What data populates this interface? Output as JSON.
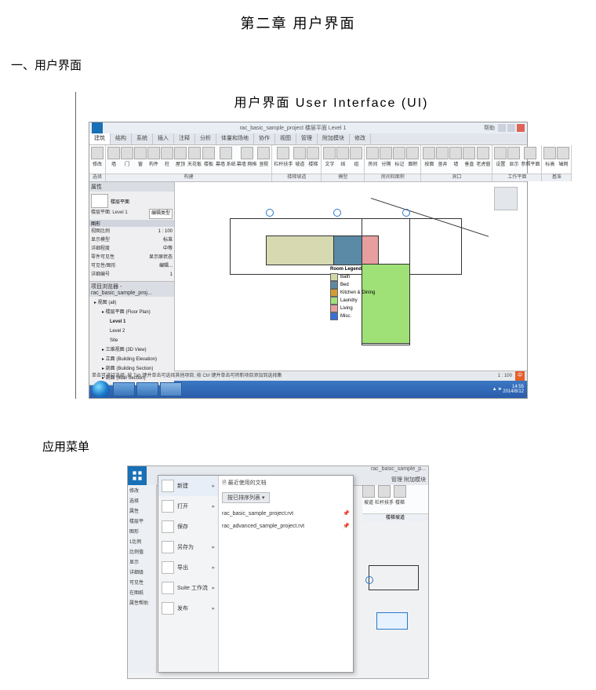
{
  "doc": {
    "chapter_title": "第二章   用户界面",
    "section": "一、用户界面",
    "subtitle": "用户界面  User Interface  (UI)",
    "section2": "应用菜单"
  },
  "revit": {
    "title_text": "rac_basic_sample_project 楼层平面 Level 1",
    "help_hint": "帮助",
    "tabs": [
      "建筑",
      "结构",
      "系统",
      "插入",
      "注释",
      "分析",
      "体量和场地",
      "协作",
      "视图",
      "管理",
      "附加模块",
      "修改"
    ],
    "ribbon_groups": [
      {
        "label": "选择",
        "items": [
          "修改"
        ]
      },
      {
        "label": "构建",
        "items": [
          "墙",
          "门",
          "窗",
          "构件",
          "柱",
          "屋顶",
          "天花板",
          "楼板",
          "幕墙 系统",
          "幕墙 网格",
          "竖梃"
        ]
      },
      {
        "label": "楼梯坡道",
        "items": [
          "栏杆扶手",
          "坡道",
          "楼梯"
        ]
      },
      {
        "label": "模型",
        "items": [
          "文字",
          "线",
          "组"
        ]
      },
      {
        "label": "房间和面积",
        "items": [
          "房间",
          "分隔",
          "标记",
          "面积"
        ]
      },
      {
        "label": "洞口",
        "items": [
          "按面",
          "竖井",
          "墙",
          "垂直",
          "老虎窗"
        ]
      },
      {
        "label": "工作平面",
        "items": [
          "设置",
          "显示",
          "参照平面"
        ]
      },
      {
        "label": "基准",
        "items": [
          "标高",
          "轴网"
        ]
      }
    ],
    "props_panel_title": "属性",
    "view_type": "楼层平面",
    "view_name": "楼层平面: Level 1",
    "edit_type": "编辑类型",
    "graphic_header": "图形",
    "props_rows": [
      {
        "k": "视图比例",
        "v": "1 : 100"
      },
      {
        "k": "显示模型",
        "v": "标准"
      },
      {
        "k": "详细程度",
        "v": "中等"
      },
      {
        "k": "零件可见性",
        "v": "显示原状态"
      },
      {
        "k": "可见性/图形",
        "v": "编辑..."
      },
      {
        "k": "详细编号",
        "v": "1"
      }
    ],
    "browser_title": "项目浏览器 - rac_basic_sample_proj...",
    "tree": [
      {
        "level": 0,
        "text": "视图 (all)"
      },
      {
        "level": 1,
        "text": "楼层平面 (Floor Plan)"
      },
      {
        "level": 2,
        "text": "Level 1",
        "bold": true
      },
      {
        "level": 2,
        "text": "Level 2"
      },
      {
        "level": 2,
        "text": "Site"
      },
      {
        "level": 1,
        "text": "三维视图 (3D View)"
      },
      {
        "level": 1,
        "text": "立面 (Building Elevation)"
      },
      {
        "level": 1,
        "text": "剖面 (Building Section)"
      },
      {
        "level": 1,
        "text": "剖面 (Wall Section)"
      }
    ],
    "legend_title": "Room Legend",
    "legend_items": [
      {
        "c": "#d3d7a2",
        "t": "Bath"
      },
      {
        "c": "#5a8aa5",
        "t": "Bed"
      },
      {
        "c": "#d59b34",
        "t": "Kitchen & Dining"
      },
      {
        "c": "#9fe077",
        "t": "Laundry"
      },
      {
        "c": "#e79e9e",
        "t": "Living"
      },
      {
        "c": "#3570d9",
        "t": "Misc."
      }
    ],
    "statusbar_left": "单击可进行选择; 按 Tab 键并单击可选择其他项目; 按 Ctrl 键并单击可将新项目添加到选择集",
    "viewcontrols": "1 : 100",
    "lang": "中",
    "taskbar_time": "14:55",
    "taskbar_date": "2014/8/12",
    "right_title_hint": "rac_basic_sample_p..."
  },
  "appmenu": {
    "items": [
      {
        "icon": "new",
        "label": "新建",
        "arrow": true
      },
      {
        "icon": "open",
        "label": "打开",
        "arrow": true
      },
      {
        "icon": "save",
        "label": "保存",
        "arrow": false
      },
      {
        "icon": "saveas",
        "label": "另存为",
        "arrow": true
      },
      {
        "icon": "export",
        "label": "导出",
        "arrow": true
      },
      {
        "icon": "suite",
        "label": "Suite 工作流",
        "arrow": true
      },
      {
        "icon": "publish",
        "label": "发布",
        "arrow": true
      }
    ],
    "recent_header": "最近使用的文档",
    "sort_label": "按已排序列表 ▾",
    "recent_files": [
      {
        "name": "rac_basic_sample_project.rvt",
        "pin": "📌"
      },
      {
        "name": "rac_advanced_sample_project.rvt",
        "pin": "📌"
      }
    ],
    "right_tabs": "管理   附加模块",
    "right_ribbon": [
      "坡道",
      "栏杆扶手",
      "楼梯"
    ],
    "right_group_label": "楼梯坡道",
    "leftstrip": [
      "修改",
      "选择",
      "属性",
      "楼层平",
      "图形",
      "1比例",
      "比例值",
      "显示",
      "详细级",
      "可见性",
      "在图纸",
      "属性帮助"
    ]
  }
}
